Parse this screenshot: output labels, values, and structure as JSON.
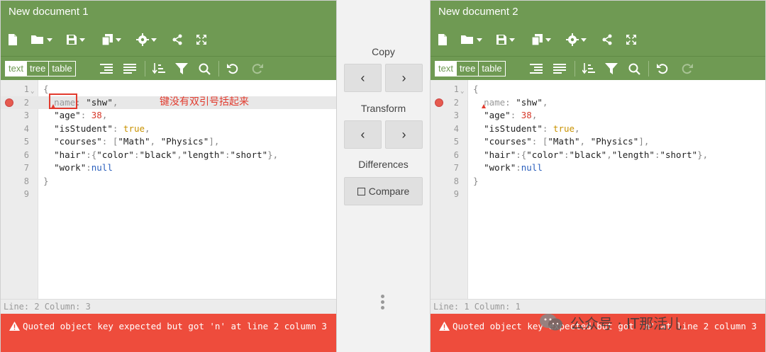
{
  "left": {
    "title": "New document 1",
    "modes": [
      "text",
      "tree",
      "table"
    ],
    "active_mode": "text",
    "lines": [
      {
        "n": "1"
      },
      {
        "n": "2"
      },
      {
        "n": "3"
      },
      {
        "n": "4"
      },
      {
        "n": "5"
      },
      {
        "n": "6"
      },
      {
        "n": "7"
      },
      {
        "n": "8"
      },
      {
        "n": "9"
      }
    ],
    "status": "Line: 2  Column: 3",
    "error": "Quoted object key expected but got 'n' at line 2 column 3",
    "annotation": "键没有双引号括起来"
  },
  "right": {
    "title": "New document 2",
    "modes": [
      "text",
      "tree",
      "table"
    ],
    "active_mode": "text",
    "status": "Line: 1  Column: 1",
    "error": "Quoted object key expected but got 'n' at line 2 column 3"
  },
  "code": {
    "l1": "{",
    "l2_key": "name",
    "l2_rest_colon": ": ",
    "l2_val": "\"shw\"",
    "l2_comma": ",",
    "l3_key": "\"age\"",
    "l3_val": "38",
    "l4_key": "\"isStudent\"",
    "l4_val": "true",
    "l5_key": "\"courses\"",
    "l5_v1": "\"Math\"",
    "l5_v2": "\"Physics\"",
    "l6_key": "\"hair\"",
    "l6_k1": "\"color\"",
    "l6_v1": "\"black\"",
    "l6_k2": "\"length\"",
    "l6_v2": "\"short\"",
    "l7_key": "\"work\"",
    "l7_val": "null",
    "l8": "}"
  },
  "middle": {
    "copy_label": "Copy",
    "transform_label": "Transform",
    "differences_label": "Differences",
    "compare_label": "Compare",
    "left_arrow": "‹",
    "right_arrow": "›"
  },
  "watermark": "公众号 · IT那活儿",
  "colors": {
    "header": "#6f9a53",
    "error_bar": "#ee4c3c",
    "annotation": "#e23b2e",
    "number": "#d7392a",
    "boolean": "#c99200",
    "null": "#2a5fbd"
  }
}
